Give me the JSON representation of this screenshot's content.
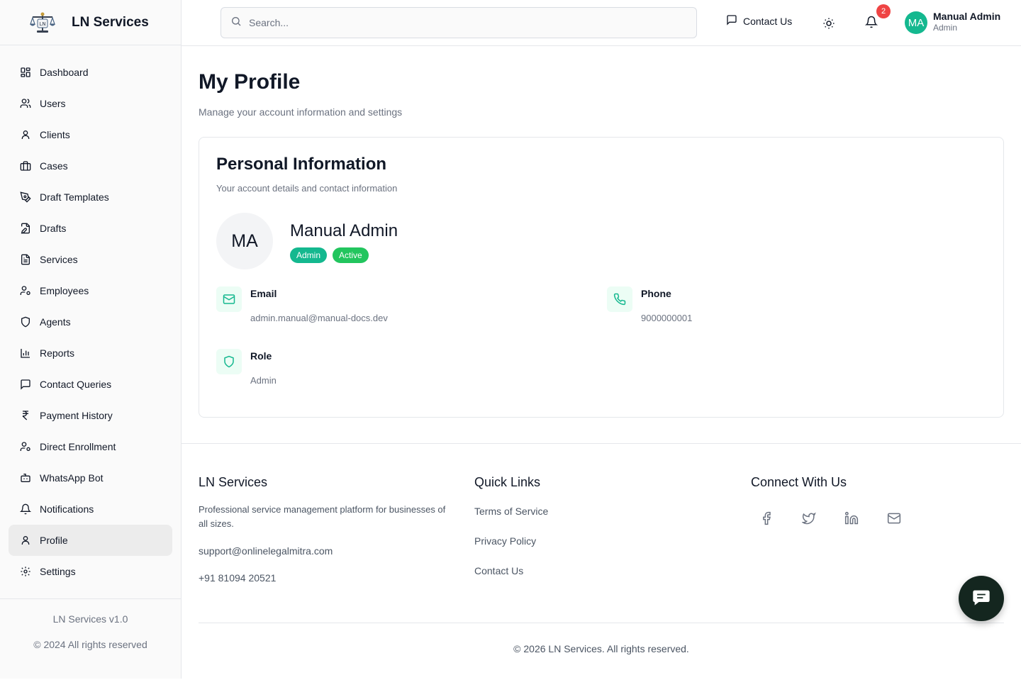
{
  "brand": {
    "name": "LN Services",
    "logo_icon": "scales-of-justice-logo"
  },
  "search": {
    "placeholder": "Search..."
  },
  "header": {
    "contact_label": "Contact Us",
    "notification_count": "2",
    "avatar_initials": "MA",
    "user_name": "Manual Admin",
    "user_role": "Admin"
  },
  "sidebar": {
    "items": [
      {
        "label": "Dashboard",
        "icon": "dashboard-icon"
      },
      {
        "label": "Users",
        "icon": "users-icon"
      },
      {
        "label": "Clients",
        "icon": "user-icon"
      },
      {
        "label": "Cases",
        "icon": "briefcase-icon"
      },
      {
        "label": "Draft Templates",
        "icon": "pen-tool-icon"
      },
      {
        "label": "Drafts",
        "icon": "edit-file-icon"
      },
      {
        "label": "Services",
        "icon": "file-text-icon"
      },
      {
        "label": "Employees",
        "icon": "user-cog-icon"
      },
      {
        "label": "Agents",
        "icon": "shield-icon"
      },
      {
        "label": "Reports",
        "icon": "bar-chart-icon"
      },
      {
        "label": "Contact Queries",
        "icon": "message-square-icon"
      },
      {
        "label": "Payment History",
        "icon": "rupee-icon"
      },
      {
        "label": "Direct Enrollment",
        "icon": "user-cog-icon"
      },
      {
        "label": "WhatsApp Bot",
        "icon": "bot-icon"
      },
      {
        "label": "Notifications",
        "icon": "bell-icon"
      },
      {
        "label": "Profile",
        "icon": "user-icon",
        "active": true
      },
      {
        "label": "Settings",
        "icon": "gear-icon"
      }
    ],
    "version": "LN Services v1.0",
    "copyright": "© 2024 All rights reserved"
  },
  "page": {
    "title": "My Profile",
    "subtitle": "Manage your account information and settings"
  },
  "card": {
    "title": "Personal Information",
    "subtitle": "Your account details and contact information",
    "avatar_initials": "MA",
    "name": "Manual Admin",
    "badges": [
      "Admin",
      "Active"
    ],
    "email_label": "Email",
    "email_value": "admin.manual@manual-docs.dev",
    "phone_label": "Phone",
    "phone_value": "9000000001",
    "role_label": "Role",
    "role_value": "Admin"
  },
  "footer": {
    "brand_title": "LN Services",
    "brand_desc": "Professional service management platform for businesses of all sizes.",
    "email": "support@onlinelegalmitra.com",
    "phone": "+91 81094 20521",
    "links_title": "Quick Links",
    "links": [
      "Terms of Service",
      "Privacy Policy",
      "Contact Us"
    ],
    "connect_title": "Connect With Us",
    "socials": [
      "facebook-icon",
      "twitter-icon",
      "linkedin-icon",
      "mail-icon"
    ],
    "copyright": "© 2026 LN Services. All rights reserved."
  },
  "colors": {
    "accent": "#14b88f",
    "active_badge": "#22c55e",
    "notification": "#ef4444",
    "chat_button": "#14261f"
  }
}
